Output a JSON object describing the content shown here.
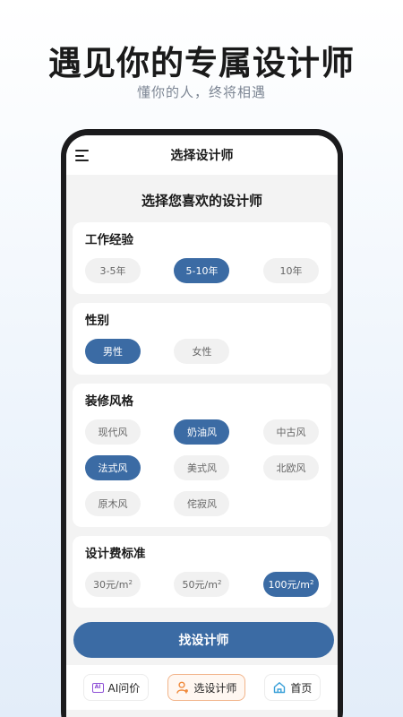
{
  "promo": {
    "headline": "遇见你的专属设计师",
    "subline": "懂你的人，终将相遇"
  },
  "header": {
    "title": "选择设计师",
    "menu_icon": "hamburger-menu-icon"
  },
  "page": {
    "heading": "选择您喜欢的设计师"
  },
  "filters": {
    "experience": {
      "label": "工作经验",
      "options": [
        "3-5年",
        "5-10年",
        "10年"
      ],
      "selected": "5-10年"
    },
    "gender": {
      "label": "性别",
      "options": [
        "男性",
        "女性"
      ],
      "selected": "男性"
    },
    "style": {
      "label": "装修风格",
      "options": [
        "现代风",
        "奶油风",
        "中古风",
        "法式风",
        "美式风",
        "北欧风",
        "原木风",
        "侘寂风"
      ],
      "selected": [
        "奶油风",
        "法式风"
      ]
    },
    "fee": {
      "label": "设计费标准",
      "options": [
        {
          "amount": "30元/m",
          "unit_sup": "2"
        },
        {
          "amount": "50元/m",
          "unit_sup": "2"
        },
        {
          "amount": "100元/m",
          "unit_sup": "2"
        }
      ],
      "selected": "100元/m"
    }
  },
  "cta": {
    "label": "找设计师"
  },
  "tabbar": {
    "items": [
      {
        "label": "AI问价",
        "icon": "ai-chat-icon",
        "icon_text": "AI"
      },
      {
        "label": "选设计师",
        "icon": "designer-person-icon"
      },
      {
        "label": "首页",
        "icon": "home-icon"
      }
    ],
    "active": "选设计师"
  },
  "colors": {
    "accent": "#3b6ba4",
    "active_tab_border": "#f2b48a",
    "ai_icon": "#8d4fd6",
    "designer_icon": "#f08a3c",
    "home_icon": "#3aa0d8"
  }
}
